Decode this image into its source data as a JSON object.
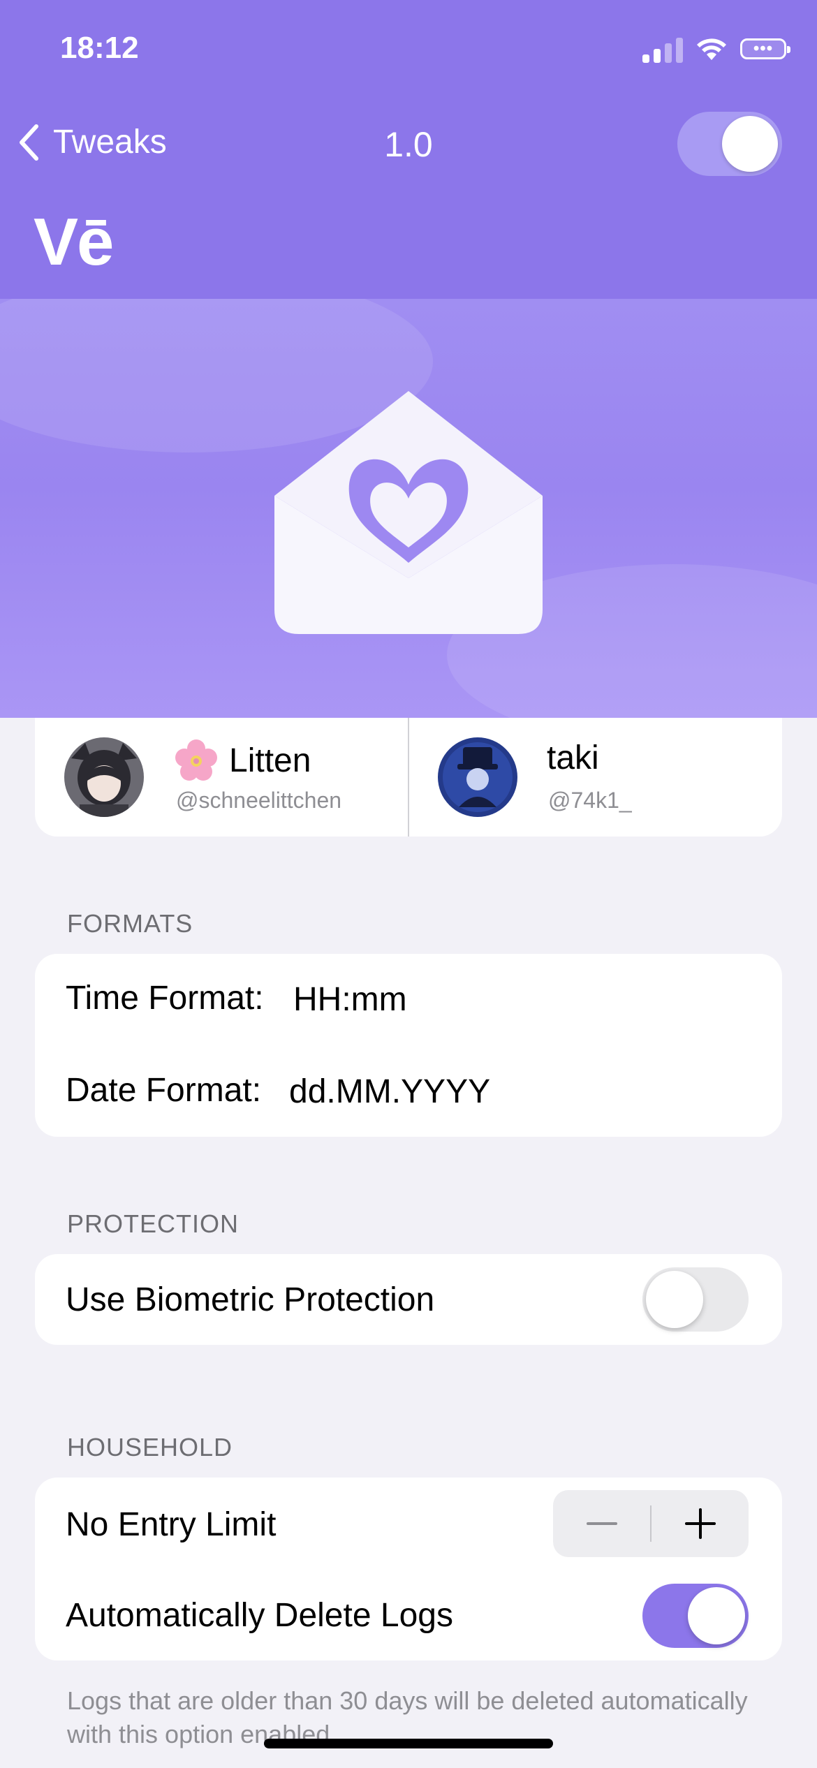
{
  "status_bar": {
    "time": "18:12",
    "battery_text": "•••"
  },
  "nav": {
    "back_label": "Tweaks",
    "title": "1.0",
    "enabled": true
  },
  "logo": "Vē",
  "developers": [
    {
      "name": "Litten",
      "handle": "@schneelittchen"
    },
    {
      "name": "taki",
      "handle": "@74k1_"
    }
  ],
  "formats": {
    "header": "FORMATS",
    "time_label": "Time Format:",
    "time_value": "HH:mm",
    "date_label": "Date Format:",
    "date_value": "dd.MM.YYYY"
  },
  "protection": {
    "header": "PROTECTION",
    "biometric_label": "Use Biometric Protection",
    "biometric_on": false
  },
  "household": {
    "header": "HOUSEHOLD",
    "entry_limit_label": "No Entry Limit",
    "auto_delete_label": "Automatically Delete Logs",
    "auto_delete_on": true,
    "footnote": "Logs that are older than 30 days will be deleted automatically with this option enabled"
  },
  "colors": {
    "accent": "#8c76ea",
    "background": "#f2f1f7",
    "secondary_text": "#8e8e93"
  }
}
